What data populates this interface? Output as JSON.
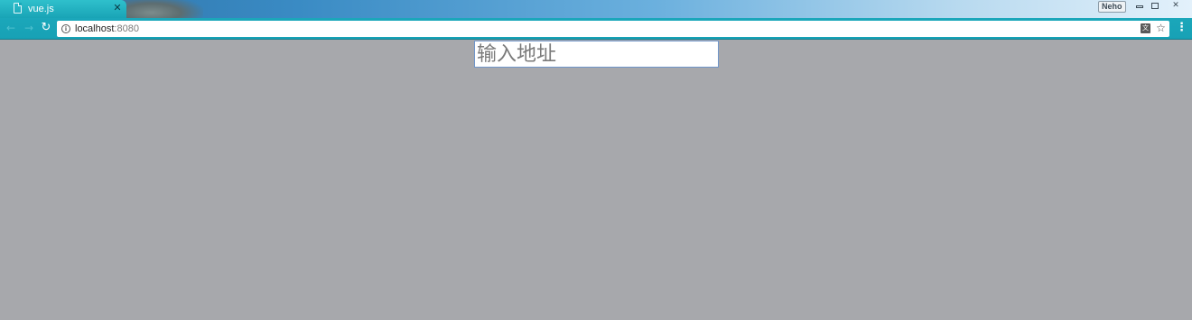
{
  "browser": {
    "tab": {
      "title": "vue.js",
      "close_glyph": "✕",
      "icon": "document-icon"
    },
    "user_badge": "Neho",
    "window_controls": {
      "minimize": "minimize-icon",
      "maximize": "maximize-icon",
      "close": "✕"
    },
    "toolbar": {
      "back_glyph": "←",
      "forward_glyph": "→",
      "reload_glyph": "↻",
      "menu_glyph": "⋮",
      "star_glyph": "☆",
      "translate_glyph": "文"
    },
    "omnibox": {
      "host": "localhost",
      "port": ":8080",
      "info_glyph": "i"
    }
  },
  "page": {
    "address_input": {
      "placeholder": "输入地址",
      "value": ""
    }
  },
  "colors": {
    "page_background": "#a7a8ac",
    "toolbar": "#1ba7ba",
    "input_border": "#6f95c9"
  }
}
